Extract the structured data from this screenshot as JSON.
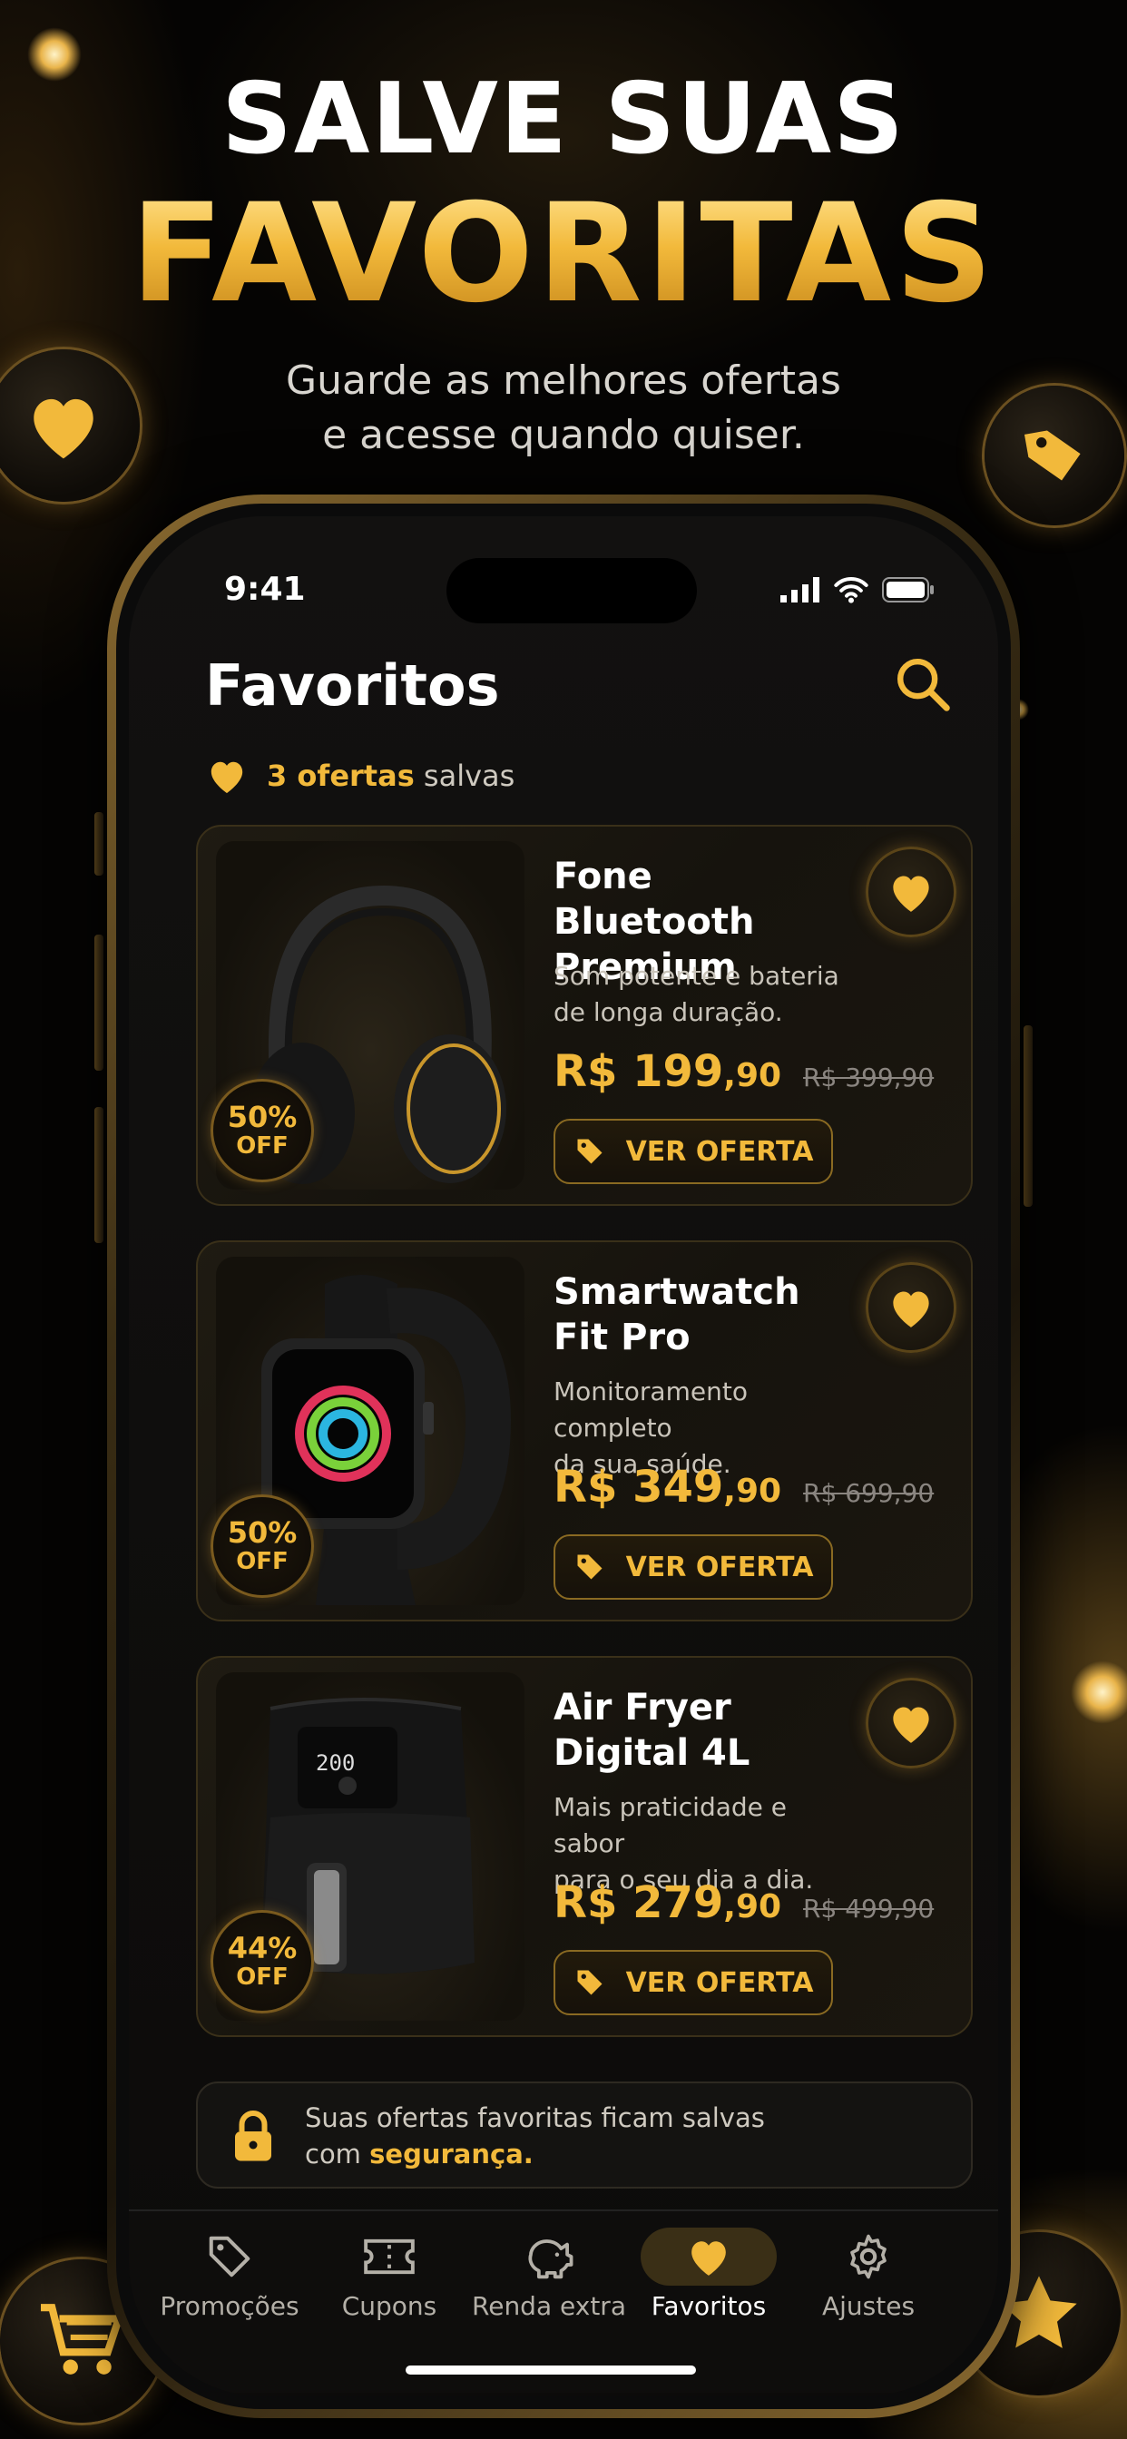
{
  "hero": {
    "line1": "SALVE SUAS",
    "line2": "FAVORITAS",
    "subtitle_1": "Guarde as melhores ofertas",
    "subtitle_2": "e acesse quando quiser."
  },
  "status_bar": {
    "time": "9:41"
  },
  "header": {
    "title": "Favoritos"
  },
  "saved": {
    "count": "3 ofertas",
    "suffix": "salvas"
  },
  "products": [
    {
      "name_1": "Fone Bluetooth",
      "name_2": "Premium",
      "desc_1": "Som potente e bateria",
      "desc_2": "de longa duração.",
      "price_main": "R$ 199",
      "price_cents": ",90",
      "price_old": "R$ 399,90",
      "discount": "50%",
      "off": "OFF",
      "cta": "VER OFERTA"
    },
    {
      "name_1": "Smartwatch",
      "name_2": "Fit Pro",
      "desc_1": "Monitoramento completo",
      "desc_2": "da sua saúde.",
      "price_main": "R$ 349",
      "price_cents": ",90",
      "price_old": "R$ 699,90",
      "discount": "50%",
      "off": "OFF",
      "cta": "VER OFERTA"
    },
    {
      "name_1": "Air Fryer",
      "name_2": "Digital 4L",
      "desc_1": "Mais praticidade e sabor",
      "desc_2": "para o seu dia a dia.",
      "price_main": "R$ 279",
      "price_cents": ",90",
      "price_old": "R$ 499,90",
      "discount": "44%",
      "off": "OFF",
      "cta": "VER OFERTA",
      "display": "200"
    }
  ],
  "secure": {
    "line1": "Suas ofertas favoritas ficam salvas",
    "line2_prefix": "com",
    "line2_highlight": "segurança."
  },
  "tabs": [
    {
      "label": "Promoções",
      "icon": "tag-icon"
    },
    {
      "label": "Cupons",
      "icon": "ticket-icon"
    },
    {
      "label": "Renda extra",
      "icon": "piggy-bank-icon"
    },
    {
      "label": "Favoritos",
      "icon": "heart-icon",
      "active": true
    },
    {
      "label": "Ajustes",
      "icon": "gear-icon"
    }
  ],
  "colors": {
    "gold": "#f2b93b",
    "background": "#050403",
    "card": "#1a160f"
  }
}
